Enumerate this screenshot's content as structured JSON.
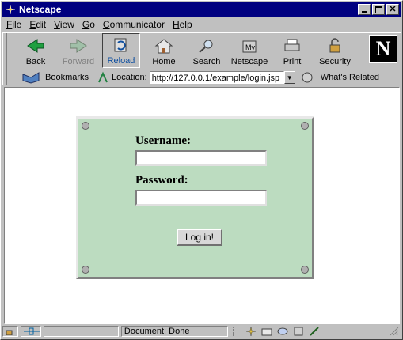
{
  "window": {
    "title": "Netscape"
  },
  "menu": [
    {
      "u": "F",
      "rest": "ile"
    },
    {
      "u": "E",
      "rest": "dit"
    },
    {
      "u": "V",
      "rest": "iew"
    },
    {
      "u": "G",
      "rest": "o"
    },
    {
      "u": "C",
      "rest": "ommunicator"
    },
    {
      "u": "H",
      "rest": "elp"
    }
  ],
  "toolbar": {
    "back": "Back",
    "forward": "Forward",
    "reload": "Reload",
    "home": "Home",
    "search": "Search",
    "netscape": "Netscape",
    "print": "Print",
    "security": "Security"
  },
  "logo": "N",
  "location": {
    "bookmarks": "Bookmarks",
    "label": "Location:",
    "url": "http://127.0.0.1/example/login.jsp",
    "whats_related": "What's Related"
  },
  "form": {
    "username_label": "Username:",
    "password_label": "Password:",
    "username_value": "",
    "password_value": "",
    "login_button": "Log in!"
  },
  "status": {
    "text": "Document: Done"
  },
  "colors": {
    "titlebar": "#000080",
    "panel": "#bcdcc0"
  }
}
